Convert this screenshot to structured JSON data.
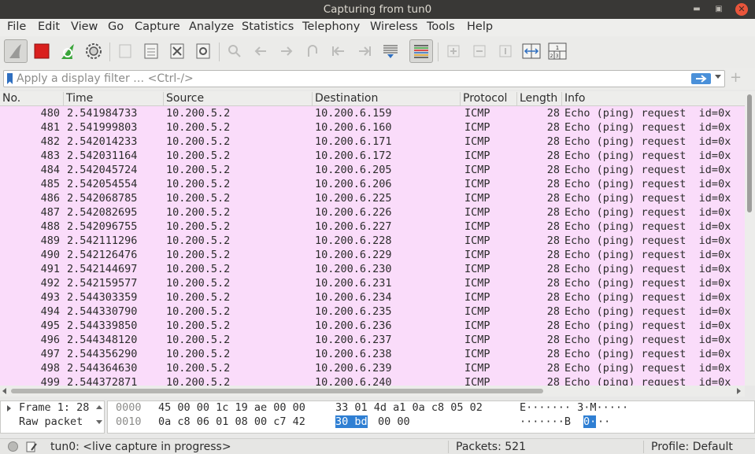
{
  "window": {
    "title": "Capturing from tun0"
  },
  "menu": [
    "File",
    "Edit",
    "View",
    "Go",
    "Capture",
    "Analyze",
    "Statistics",
    "Telephony",
    "Wireless",
    "Tools",
    "Help"
  ],
  "toolbar": {
    "icons": [
      "shark-fin-start-icon",
      "stop-capture-icon",
      "restart-capture-icon",
      "capture-options-gear-icon",
      "open-file-icon",
      "save-file-icon",
      "close-file-icon",
      "reload-file-icon",
      "find-packet-icon",
      "go-back-icon",
      "go-forward-icon",
      "go-to-packet-icon",
      "go-first-packet-icon",
      "go-last-packet-icon",
      "autoscroll-icon",
      "colorize-icon",
      "zoom-in-icon",
      "zoom-out-icon",
      "normal-size-icon",
      "resize-columns-icon",
      "layout-icon"
    ]
  },
  "filter": {
    "placeholder": "Apply a display filter … <Ctrl-/>"
  },
  "columns": [
    "No.",
    "Time",
    "Source",
    "Destination",
    "Protocol",
    "Length",
    "Info"
  ],
  "packets": [
    {
      "no": "480",
      "time": "2.541984733",
      "src": "10.200.5.2",
      "dst": "10.200.6.159",
      "proto": "ICMP",
      "len": "28",
      "info": "Echo (ping) request  id=0x"
    },
    {
      "no": "481",
      "time": "2.541999803",
      "src": "10.200.5.2",
      "dst": "10.200.6.160",
      "proto": "ICMP",
      "len": "28",
      "info": "Echo (ping) request  id=0x"
    },
    {
      "no": "482",
      "time": "2.542014233",
      "src": "10.200.5.2",
      "dst": "10.200.6.171",
      "proto": "ICMP",
      "len": "28",
      "info": "Echo (ping) request  id=0x"
    },
    {
      "no": "483",
      "time": "2.542031164",
      "src": "10.200.5.2",
      "dst": "10.200.6.172",
      "proto": "ICMP",
      "len": "28",
      "info": "Echo (ping) request  id=0x"
    },
    {
      "no": "484",
      "time": "2.542045724",
      "src": "10.200.5.2",
      "dst": "10.200.6.205",
      "proto": "ICMP",
      "len": "28",
      "info": "Echo (ping) request  id=0x"
    },
    {
      "no": "485",
      "time": "2.542054554",
      "src": "10.200.5.2",
      "dst": "10.200.6.206",
      "proto": "ICMP",
      "len": "28",
      "info": "Echo (ping) request  id=0x"
    },
    {
      "no": "486",
      "time": "2.542068785",
      "src": "10.200.5.2",
      "dst": "10.200.6.225",
      "proto": "ICMP",
      "len": "28",
      "info": "Echo (ping) request  id=0x"
    },
    {
      "no": "487",
      "time": "2.542082695",
      "src": "10.200.5.2",
      "dst": "10.200.6.226",
      "proto": "ICMP",
      "len": "28",
      "info": "Echo (ping) request  id=0x"
    },
    {
      "no": "488",
      "time": "2.542096755",
      "src": "10.200.5.2",
      "dst": "10.200.6.227",
      "proto": "ICMP",
      "len": "28",
      "info": "Echo (ping) request  id=0x"
    },
    {
      "no": "489",
      "time": "2.542111296",
      "src": "10.200.5.2",
      "dst": "10.200.6.228",
      "proto": "ICMP",
      "len": "28",
      "info": "Echo (ping) request  id=0x"
    },
    {
      "no": "490",
      "time": "2.542126476",
      "src": "10.200.5.2",
      "dst": "10.200.6.229",
      "proto": "ICMP",
      "len": "28",
      "info": "Echo (ping) request  id=0x"
    },
    {
      "no": "491",
      "time": "2.542144697",
      "src": "10.200.5.2",
      "dst": "10.200.6.230",
      "proto": "ICMP",
      "len": "28",
      "info": "Echo (ping) request  id=0x"
    },
    {
      "no": "492",
      "time": "2.542159577",
      "src": "10.200.5.2",
      "dst": "10.200.6.231",
      "proto": "ICMP",
      "len": "28",
      "info": "Echo (ping) request  id=0x"
    },
    {
      "no": "493",
      "time": "2.544303359",
      "src": "10.200.5.2",
      "dst": "10.200.6.234",
      "proto": "ICMP",
      "len": "28",
      "info": "Echo (ping) request  id=0x"
    },
    {
      "no": "494",
      "time": "2.544330790",
      "src": "10.200.5.2",
      "dst": "10.200.6.235",
      "proto": "ICMP",
      "len": "28",
      "info": "Echo (ping) request  id=0x"
    },
    {
      "no": "495",
      "time": "2.544339850",
      "src": "10.200.5.2",
      "dst": "10.200.6.236",
      "proto": "ICMP",
      "len": "28",
      "info": "Echo (ping) request  id=0x"
    },
    {
      "no": "496",
      "time": "2.544348120",
      "src": "10.200.5.2",
      "dst": "10.200.6.237",
      "proto": "ICMP",
      "len": "28",
      "info": "Echo (ping) request  id=0x"
    },
    {
      "no": "497",
      "time": "2.544356290",
      "src": "10.200.5.2",
      "dst": "10.200.6.238",
      "proto": "ICMP",
      "len": "28",
      "info": "Echo (ping) request  id=0x"
    },
    {
      "no": "498",
      "time": "2.544364630",
      "src": "10.200.5.2",
      "dst": "10.200.6.239",
      "proto": "ICMP",
      "len": "28",
      "info": "Echo (ping) request  id=0x"
    },
    {
      "no": "499",
      "time": "2.544372871",
      "src": "10.200.5.2",
      "dst": "10.200.6.240",
      "proto": "ICMP",
      "len": "28",
      "info": "Echo (ping) request  id=0x"
    }
  ],
  "detail": {
    "items": [
      "Frame 1: 28",
      "Raw packet"
    ]
  },
  "bytes": [
    {
      "offset": "0000",
      "hex_a": "45 00 00 1c 19 ae 00 00",
      "hex_b": "33 01 4d a1 0a c8 05 02",
      "ascii": "E······· 3·M·····"
    },
    {
      "offset": "0010",
      "hex_a": "0a c8 06 01 08 00 c7 42",
      "hex_b_sel": "30 bd",
      "hex_b_rest": "00 00",
      "ascii_pre": "·······B ",
      "ascii_sel": "0·",
      "ascii_post": "··"
    }
  ],
  "status": {
    "capture": "tun0: <live capture in progress>",
    "packets": "Packets: 521",
    "profile": "Profile: Default"
  },
  "colors": {
    "row_icmp": "#fadcfa",
    "selection": "#2f7fd3",
    "stop_red": "#d9201e",
    "restart_green": "#3aa53a"
  }
}
